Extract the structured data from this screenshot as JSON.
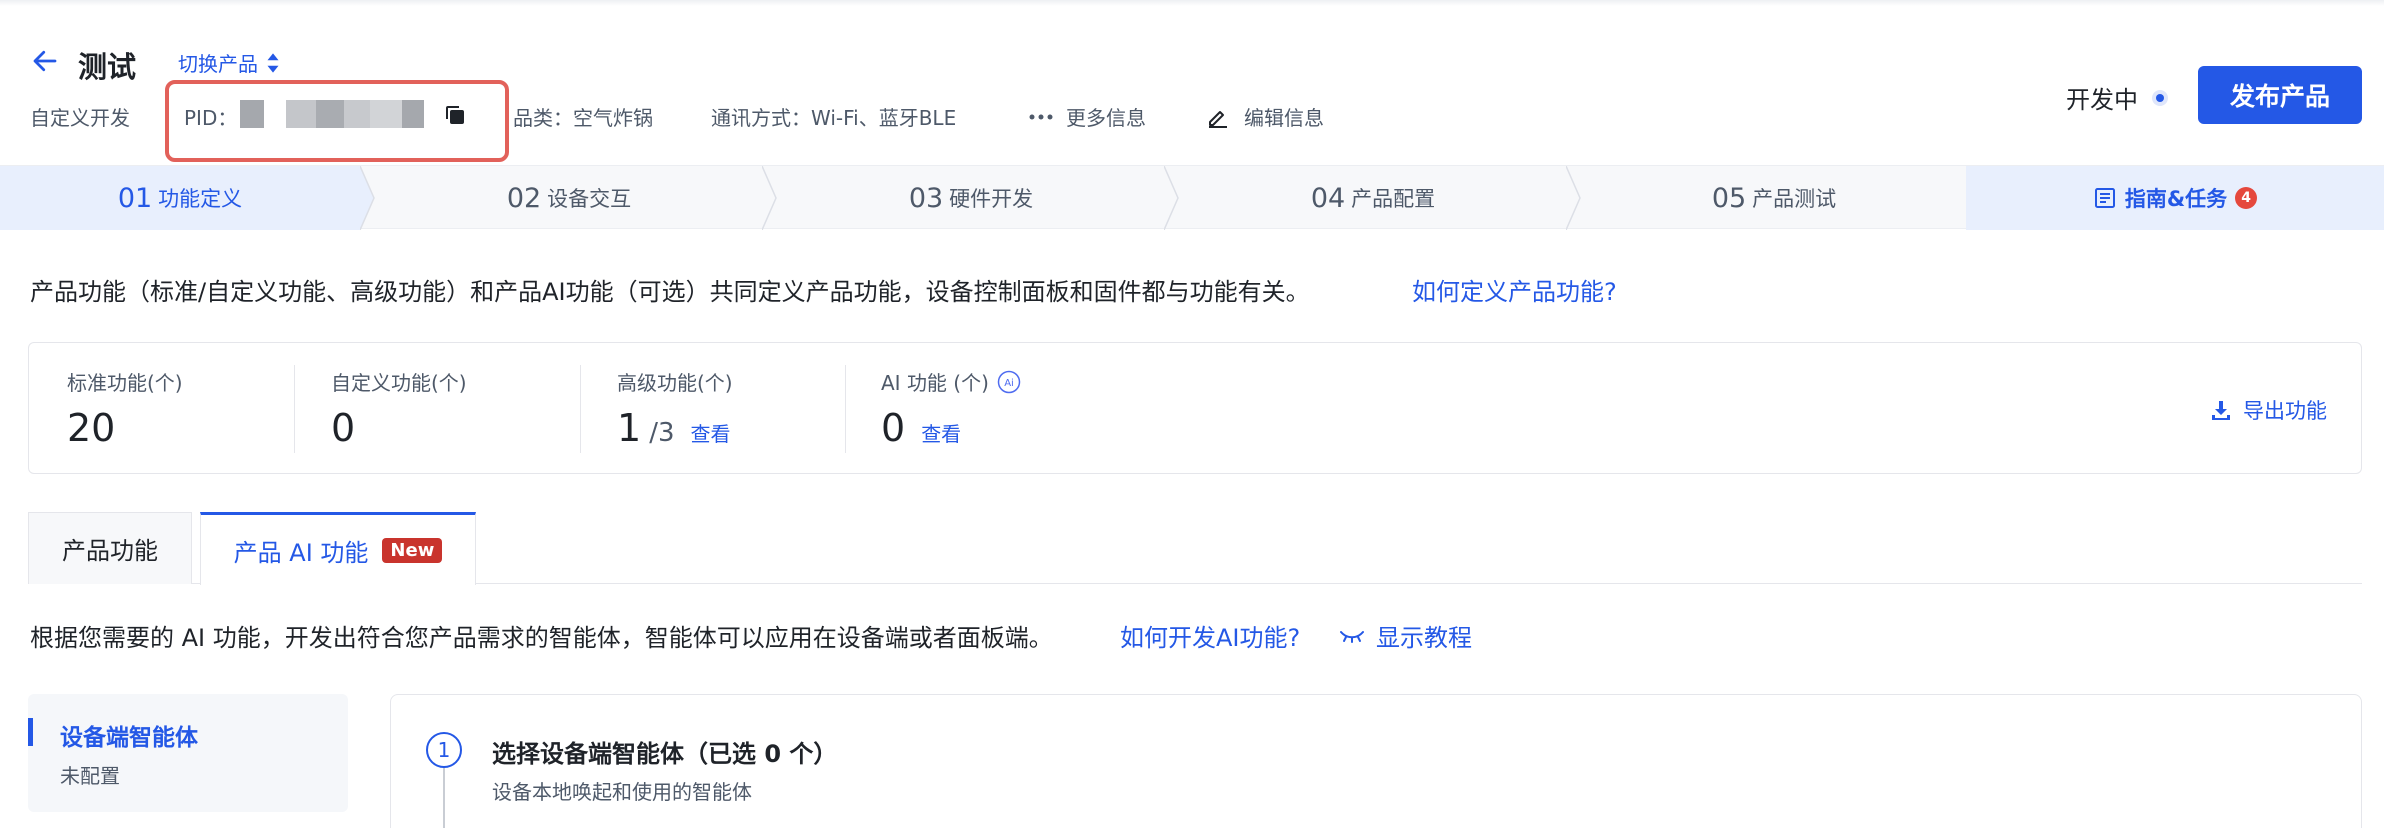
{
  "header": {
    "title": "测试",
    "switch_product": "切换产品",
    "dev_type": "自定义开发",
    "pid_label": "PID：",
    "category": "品类：空气炸锅",
    "comm": "通讯方式：Wi-Fi、蓝牙BLE",
    "more_info": "更多信息",
    "edit_info": "编辑信息",
    "status": "开发中",
    "publish": "发布产品"
  },
  "steps": [
    {
      "num": "01",
      "label": "功能定义"
    },
    {
      "num": "02",
      "label": "设备交互"
    },
    {
      "num": "03",
      "label": "硬件开发"
    },
    {
      "num": "04",
      "label": "产品配置"
    },
    {
      "num": "05",
      "label": "产品测试"
    }
  ],
  "guide": {
    "label": "指南&任务",
    "count": "4"
  },
  "intro": {
    "text": "产品功能（标准/自定义功能、高级功能）和产品AI功能（可选）共同定义产品功能，设备控制面板和固件都与功能有关。",
    "link": "如何定义产品功能?"
  },
  "stats": {
    "standard": {
      "label": "标准功能(个)",
      "value": "20"
    },
    "custom": {
      "label": "自定义功能(个)",
      "value": "0"
    },
    "advanced": {
      "label": "高级功能(个)",
      "value": "1",
      "total": "/3",
      "link": "查看"
    },
    "ai": {
      "label": "AI 功能 (个)",
      "value": "0",
      "link": "查看"
    },
    "export": "导出功能"
  },
  "tabs": {
    "product_functions": "产品功能",
    "product_ai": "产品 AI 功能",
    "new_badge": "New"
  },
  "ai_section": {
    "desc": "根据您需要的 AI 功能，开发出符合您产品需求的智能体，智能体可以应用在设备端或者面板端。",
    "link": "如何开发AI功能?",
    "tutorial": "显示教程"
  },
  "side_menu": {
    "title": "设备端智能体",
    "sub": "未配置"
  },
  "content": {
    "step_no": "1",
    "title": "选择设备端智能体（已选 0 个）",
    "sub": "设备本地唤起和使用的智能体"
  },
  "colors": {
    "primary": "#2458e6",
    "danger": "#e5483d",
    "highlight_border": "#e2615a"
  }
}
